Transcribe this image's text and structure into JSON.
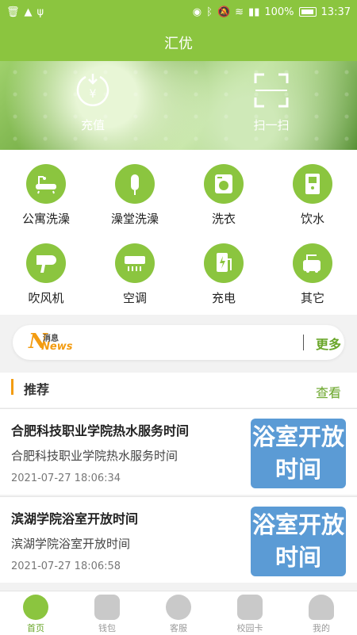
{
  "status_bar": {
    "battery": "100%",
    "time": "13:37"
  },
  "header": {
    "title": "汇优"
  },
  "banner": {
    "left": {
      "label": "充值",
      "icon": "yen-download-icon"
    },
    "right": {
      "label": "扫一扫",
      "icon": "scan-icon"
    }
  },
  "services": [
    {
      "label": "公寓洗澡",
      "icon": "bathtub-icon"
    },
    {
      "label": "澡堂洗澡",
      "icon": "shower-icon"
    },
    {
      "label": "洗衣",
      "icon": "washing-machine-icon"
    },
    {
      "label": "饮水",
      "icon": "water-dispenser-icon"
    },
    {
      "label": "吹风机",
      "icon": "hair-dryer-icon"
    },
    {
      "label": "空调",
      "icon": "air-conditioner-icon"
    },
    {
      "label": "充电",
      "icon": "charging-icon"
    },
    {
      "label": "其它",
      "icon": "other-icon"
    }
  ],
  "news": {
    "logo_cn": "消息",
    "logo_en": "News",
    "more": "更多"
  },
  "recommend": {
    "title": "推荐",
    "more": "查看"
  },
  "items": [
    {
      "title": "合肥科技职业学院热水服务时间",
      "subtitle": "合肥科技职业学院热水服务时间",
      "date": "2021-07-27 18:06:34",
      "thumb": "浴室开放时间"
    },
    {
      "title": "滨湖学院浴室开放时间",
      "subtitle": "滨湖学院浴室开放时间",
      "date": "2021-07-27 18:06:58",
      "thumb": "浴室开放时间"
    }
  ],
  "tabs": [
    {
      "label": "首页",
      "icon": "home-icon"
    },
    {
      "label": "钱包",
      "icon": "wallet-icon"
    },
    {
      "label": "客服",
      "icon": "headset-icon"
    },
    {
      "label": "校园卡",
      "icon": "card-icon"
    },
    {
      "label": "我的",
      "icon": "user-icon"
    }
  ],
  "colors": {
    "primary": "#8bc53f",
    "accent": "#f39c12",
    "thumb": "#5b9bd5"
  }
}
